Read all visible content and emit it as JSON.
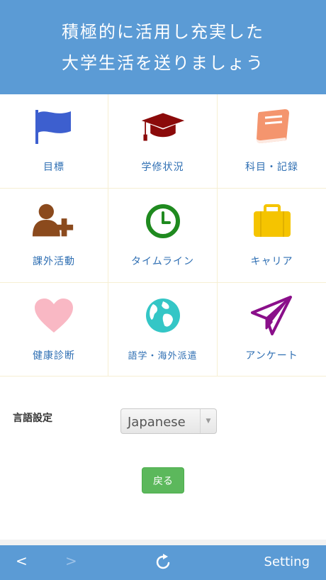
{
  "header": {
    "line1": "積極的に活用し充実した",
    "line2": "大学生活を送りましょう"
  },
  "menu": [
    {
      "label": "目標",
      "icon": "flag-icon"
    },
    {
      "label": "学修状況",
      "icon": "graduation-cap-icon"
    },
    {
      "label": "科目・記録",
      "icon": "book-icon"
    },
    {
      "label": "課外活動",
      "icon": "user-plus-icon"
    },
    {
      "label": "タイムライン",
      "icon": "clock-icon"
    },
    {
      "label": "キャリア",
      "icon": "briefcase-icon"
    },
    {
      "label": "健康診断",
      "icon": "heart-icon"
    },
    {
      "label": "語学・海外派遣",
      "icon": "globe-icon"
    },
    {
      "label": "アンケート",
      "icon": "paper-plane-icon"
    }
  ],
  "settings": {
    "language_label": "言語設定",
    "language_value": "Japanese",
    "back_button": "戻る"
  },
  "toolbar": {
    "back": "<",
    "forward": ">",
    "setting": "Setting"
  },
  "colors": {
    "header_bg": "#5b9bd5",
    "label_text": "#2f6fb3",
    "button_green": "#5cb85c"
  }
}
